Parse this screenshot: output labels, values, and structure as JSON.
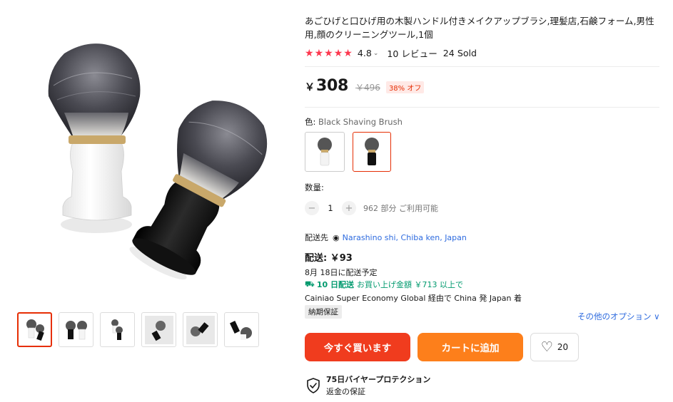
{
  "product": {
    "title": "あごひげと口ひげ用の木製ハンドル付きメイクアップブラシ,理髪店,石鹸フォーム,男性用,顔のクリーニングツール,1個",
    "rating_value": "4.8",
    "reviews": "10 レビュー",
    "sold": "24 Sold",
    "star_color": "#fd384f",
    "star_glyph": "★"
  },
  "price": {
    "currency": "￥",
    "current": "308",
    "original": "￥496",
    "discount": "38% オフ"
  },
  "variant": {
    "label": "色:",
    "selected": "Black Shaving Brush"
  },
  "quantity": {
    "label": "数量:",
    "minus": "−",
    "value": "1",
    "plus": "+",
    "available": "962 部分 ご利用可能"
  },
  "shipping": {
    "ship_to_label": "配送先",
    "location": "Narashino shi, Chiba ken, Japan",
    "fee": "配送: ￥93",
    "date": "8月 18日に配送予定",
    "fast_days": "10 日配送",
    "fast_condition": "お買い上げ金額 ￥713 以上で",
    "carrier": "Cainiao Super Economy Global 経由で China 発 Japan 着",
    "badge": "納期保証",
    "more_options": "その他のオプション ∨"
  },
  "actions": {
    "buy_now": "今すぐ買います",
    "add_to_cart": "カートに追加",
    "wishlist_count": "20"
  },
  "protection": {
    "title": "75日バイヤープロテクション",
    "subtitle": "返金の保証"
  },
  "colors": {
    "accent": "#e62e04",
    "link": "#2e6bdf",
    "fast_green": "#009a6e",
    "buy_button": "#f03c1e",
    "cart_button": "#fd7f1b"
  }
}
